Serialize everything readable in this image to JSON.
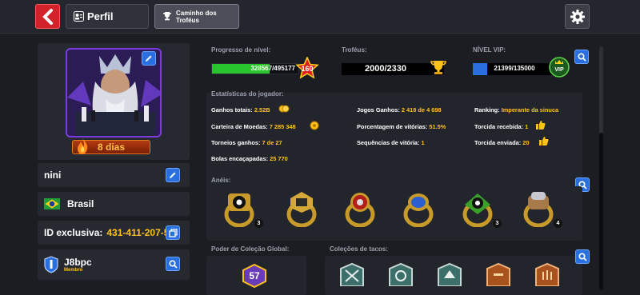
{
  "topbar": {
    "tab_profile": "Perfil",
    "tab_trophy_road": "Caminho dos Troféus"
  },
  "profile": {
    "streak_days": "8 dias",
    "username": "nini",
    "country": "Brasil",
    "exclusive_id_label": "ID exclusiva:",
    "exclusive_id_value": "431-411-207-5",
    "club_name": "J8bpc",
    "club_role": "Membro"
  },
  "progress": {
    "level_label": "Progresso de nível:",
    "level_text": "328567/495177",
    "level_fraction": 0.6635,
    "level": "160",
    "trophies_label": "Troféus:",
    "trophies_text": "2000/2330",
    "vip_label": "NÍVEL VIP:",
    "vip_text": "21399/135000",
    "vip_fraction": 0.1585
  },
  "stats": {
    "section_label": "Estatísticas do jogador:",
    "total_winnings_label": "Ganhos totais:",
    "total_winnings_value": "2.52B",
    "coin_wallet_label": "Carteira de Moedas:",
    "coin_wallet_value": "7 285 348",
    "tournaments_label": "Torneios ganhos:",
    "tournaments_value": "7 de 27",
    "balls_label": "Bolas encaçapadas:",
    "balls_value": "25 770",
    "games_won_label": "Jogos Ganhos:",
    "games_won_value": "2 418 de 4 698",
    "win_pct_label": "Porcentagem de vitórias:",
    "win_pct_value": "51.5%",
    "streak_label": "Sequências de vitória:",
    "streak_value": "1",
    "ranking_label": "Ranking:",
    "ranking_value": "Imperante da sinuca",
    "cheers_received_label": "Torcida recebida:",
    "cheers_received_value": "1",
    "cheers_sent_label": "Torcida enviada:",
    "cheers_sent_value": "20"
  },
  "rings": {
    "section_label": "Anéis:",
    "counts": [
      "3",
      "",
      "",
      "",
      "3",
      "4"
    ]
  },
  "collections": {
    "global_power_label": "Poder de Coleção Global:",
    "global_power_value": "57",
    "cue_collections_label": "Coleções de tacos:"
  },
  "colors": {
    "accent_red": "#d2232a",
    "accent_blue": "#2a6fe0",
    "gold_text": "#ffc21a",
    "level_green": "#27c42d"
  }
}
